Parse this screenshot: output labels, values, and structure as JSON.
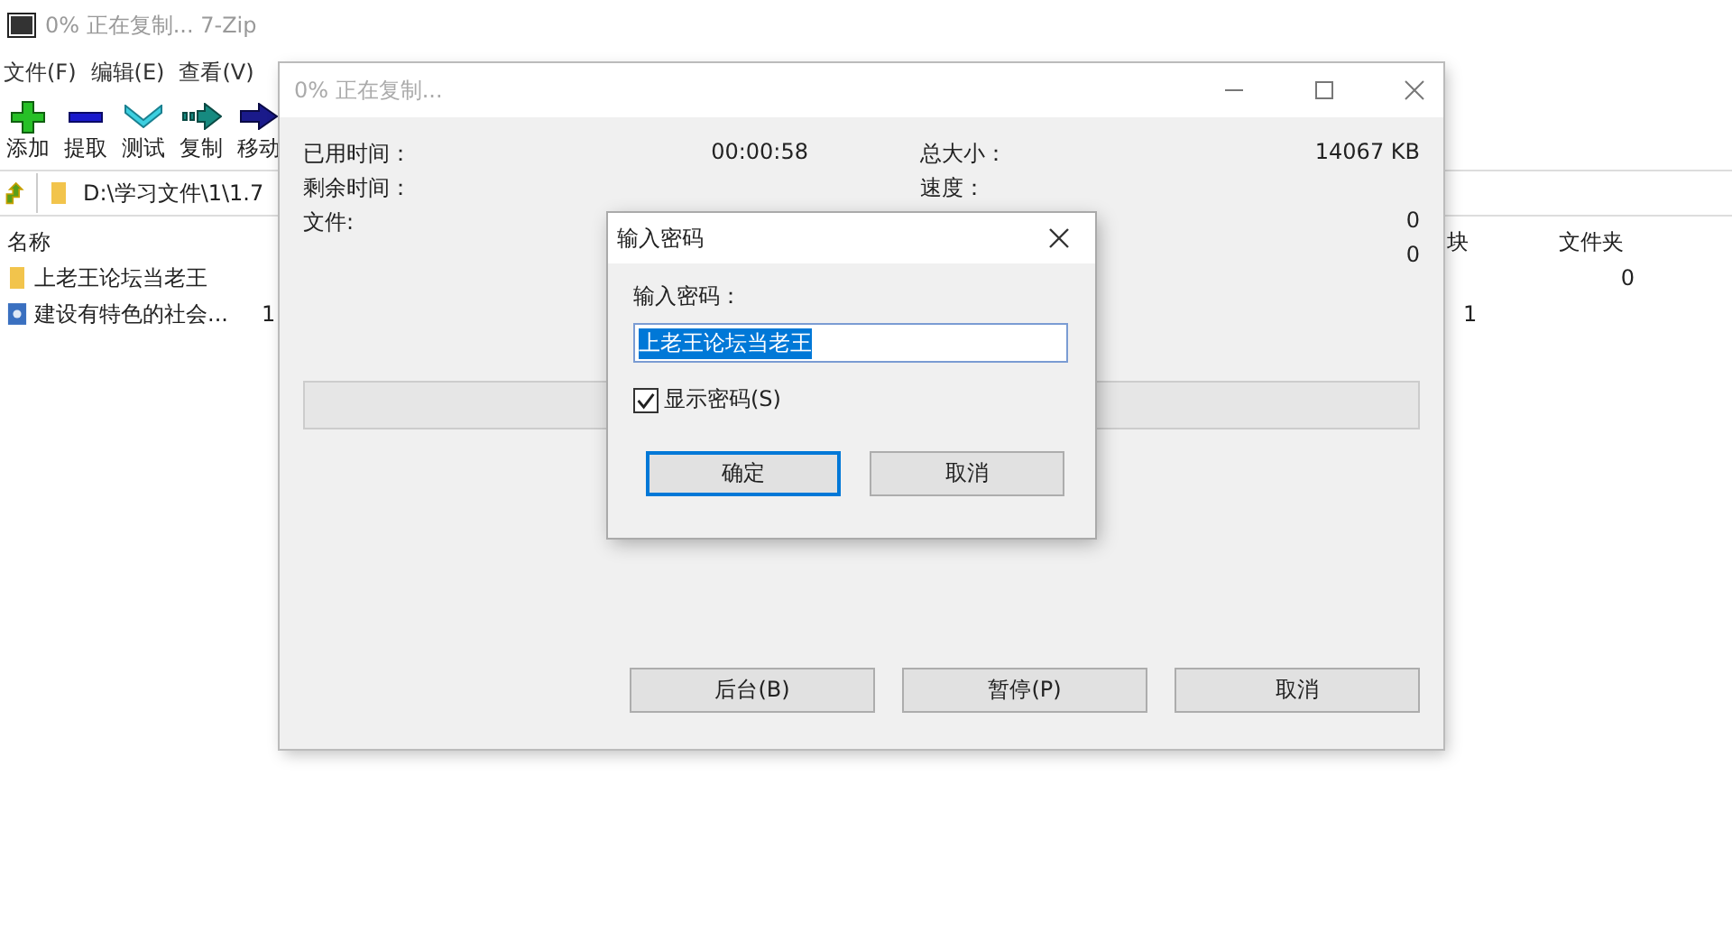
{
  "main_window": {
    "title": "0% 正在复制... 7-Zip",
    "menu": [
      "文件(F)",
      "编辑(E)",
      "查看(V)"
    ],
    "toolbar": [
      {
        "kind": "add",
        "label": "添加"
      },
      {
        "kind": "extract",
        "label": "提取"
      },
      {
        "kind": "test",
        "label": "测试"
      },
      {
        "kind": "copy",
        "label": "复制"
      },
      {
        "kind": "move",
        "label": "移动"
      }
    ],
    "address": "D:\\学习文件\\1\\1.7",
    "columns": {
      "name": "名称",
      "blocks": "块",
      "folders": "文件夹"
    },
    "rows": [
      {
        "kind": "folder",
        "name": "上老王论坛当老王",
        "folders": "0"
      },
      {
        "kind": "file",
        "name": "建设有特色的社会...",
        "column_2": "1",
        "blocks": "1"
      }
    ]
  },
  "progress_dialog": {
    "title": "0% 正在复制...",
    "left_stats": [
      {
        "label": "已用时间：",
        "value": "00:00:58"
      },
      {
        "label": "剩余时间："
      },
      {
        "label": "文件:"
      }
    ],
    "right_stats": [
      {
        "label": "总大小：",
        "value": "14067 KB"
      },
      {
        "label": "速度："
      },
      {
        "value": "0"
      },
      {
        "value": "0"
      }
    ],
    "progress": {
      "level": 0
    },
    "buttons": [
      "后台(B)",
      "暂停(P)",
      "取消"
    ]
  },
  "password_dialog": {
    "title": "输入密码",
    "field_label": "输入密码：",
    "value": "上老王论坛当老王",
    "show_password": {
      "label": "显示密码(S)",
      "checked": true
    },
    "buttons": [
      {
        "label": "确定",
        "default": true
      },
      {
        "label": "取消",
        "default": false
      }
    ]
  }
}
